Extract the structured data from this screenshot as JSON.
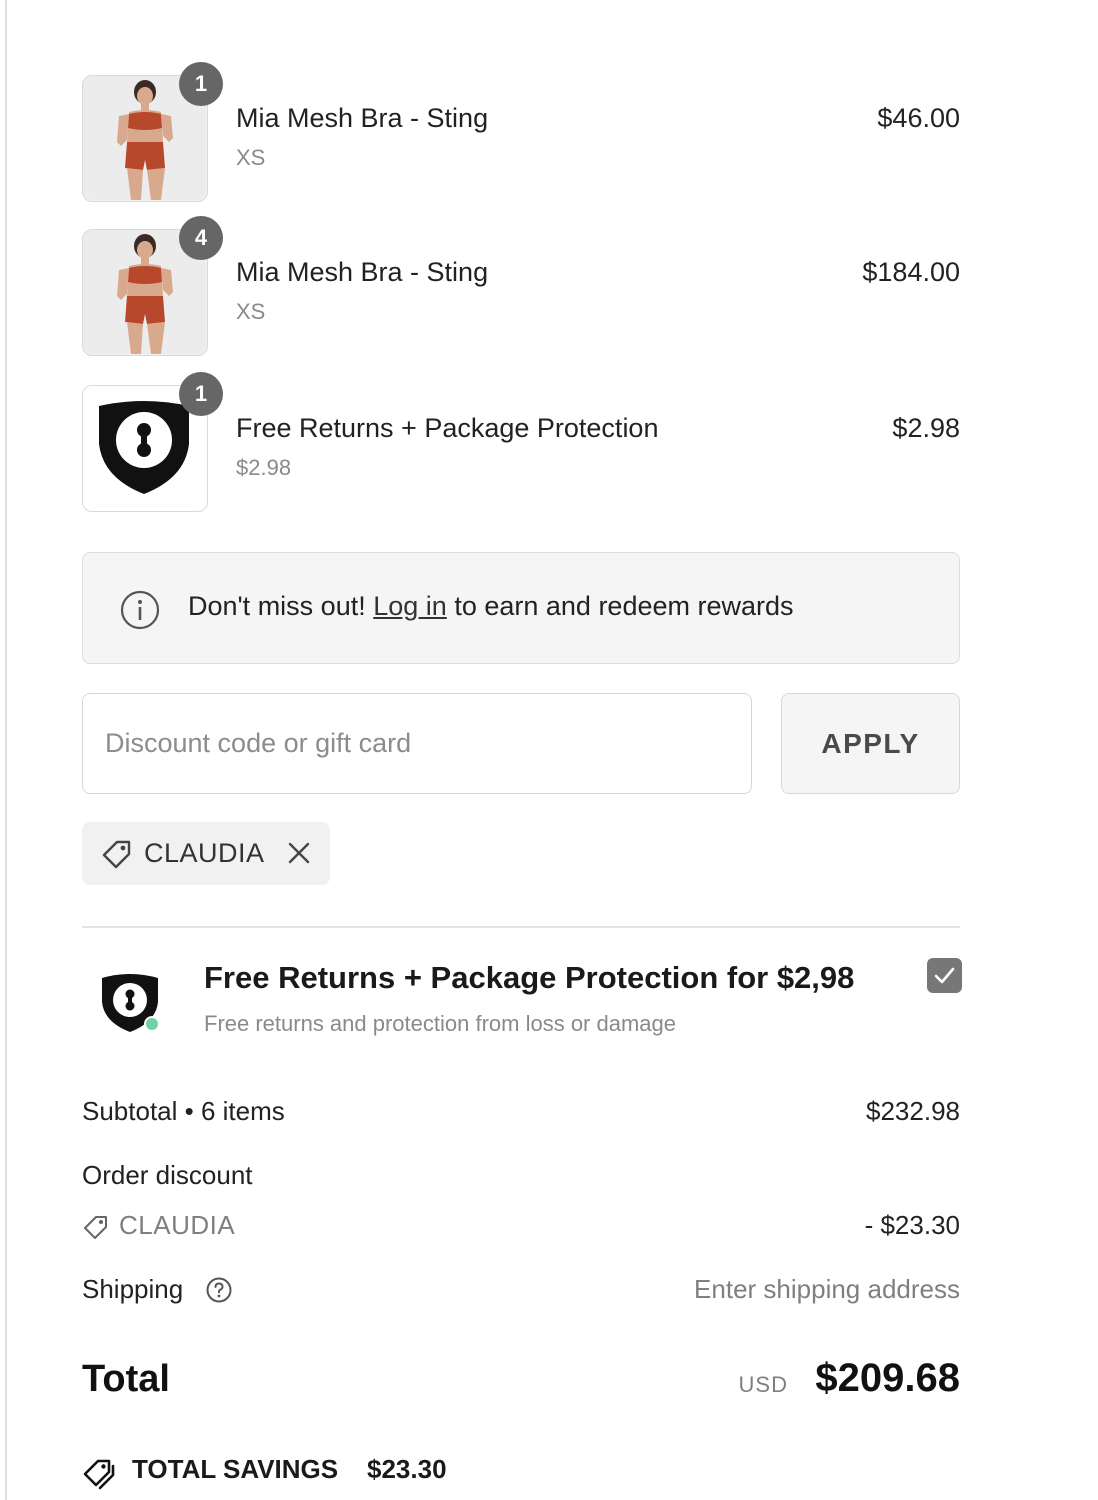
{
  "line_items": [
    {
      "quantity": "1",
      "name": "Mia Mesh Bra - Sting",
      "variant": "XS",
      "price": "$46.00",
      "image": "model-photo"
    },
    {
      "quantity": "4",
      "name": "Mia Mesh Bra - Sting",
      "variant": "XS",
      "price": "$184.00",
      "image": "model-photo"
    },
    {
      "quantity": "1",
      "name": "Free Returns + Package Protection",
      "variant": "$2.98",
      "price": "$2.98",
      "image": "shield-logo"
    }
  ],
  "rewards": {
    "icon": "info-icon",
    "prefix": "Don't miss out!",
    "link": "Log in",
    "suffix": "to earn and redeem rewards"
  },
  "discount": {
    "placeholder": "Discount code or gift card",
    "value": "",
    "apply_label": "APPLY",
    "applied_code": "CLAUDIA"
  },
  "protection": {
    "title": "Free Returns + Package Protection for $2,98",
    "subtitle": "Free returns and protection from loss or damage",
    "checked": true,
    "check_color": "#777777"
  },
  "summary": {
    "subtotal_label": "Subtotal • 6 items",
    "subtotal_value": "$232.98",
    "discount_label": "Order discount",
    "discount_code": "CLAUDIA",
    "discount_value": "- $23.30",
    "shipping_label": "Shipping",
    "shipping_value": "Enter shipping address",
    "total_label": "Total",
    "currency": "USD",
    "total_value": "$209.68",
    "savings_label": "TOTAL SAVINGS",
    "savings_value": "$23.30"
  },
  "colors": {
    "product_red": "#b8482c",
    "badge_gray": "#666666"
  }
}
